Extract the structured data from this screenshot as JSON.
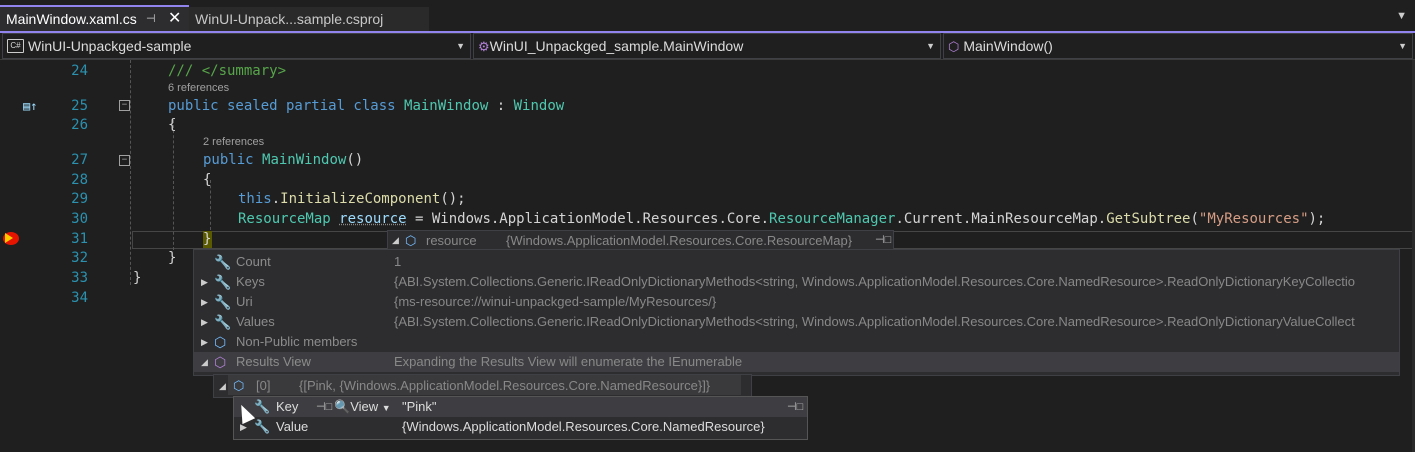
{
  "tabs": [
    {
      "label": "MainWindow.xaml.cs",
      "active": true
    },
    {
      "label": "WinUI-Unpack...sample.csproj",
      "active": false
    }
  ],
  "navbar": {
    "project": "WinUI-Unpackged-sample",
    "class_scope": "WinUI_Unpackged_sample.MainWindow",
    "member_scope": "MainWindow()"
  },
  "editor": {
    "line_numbers": [
      "24",
      "25",
      "26",
      "27",
      "28",
      "29",
      "30",
      "31",
      "32",
      "33",
      "34"
    ],
    "refs_class": "6 references",
    "refs_ctor": "2 references",
    "code": {
      "l24": "/// </summary>",
      "l25_kw": "public sealed partial class ",
      "l25_name": "MainWindow",
      "l25_colon": " : ",
      "l25_base": "Window",
      "l26": "{",
      "l27_kw": "public ",
      "l27_name": "MainWindow",
      "l27_parens": "()",
      "l28": "{",
      "l29_this": "this",
      "l29_dot": ".",
      "l29_call": "InitializeComponent",
      "l29_end": "();",
      "l30_type": "ResourceMap",
      "l30_var": "resource",
      "l30_eq": " = Windows.ApplicationModel.Resources.Core.",
      "l30_rm": "ResourceManager",
      "l30_mid": ".Current.MainResourceMap.",
      "l30_call": "GetSubtree",
      "l30_open": "(",
      "l30_str": "\"MyResources\"",
      "l30_close": ");",
      "l31": "}",
      "l32": "}",
      "l33": "}"
    }
  },
  "datatip": {
    "name": "resource",
    "value": "{Windows.ApplicationModel.Resources.Core.ResourceMap}",
    "rows": [
      {
        "name": "Count",
        "value": "1"
      },
      {
        "name": "Keys",
        "value": "{ABI.System.Collections.Generic.IReadOnlyDictionaryMethods<string, Windows.ApplicationModel.Resources.Core.NamedResource>.ReadOnlyDictionaryKeyCollectio"
      },
      {
        "name": "Uri",
        "value": "{ms-resource://winui-unpackged-sample/MyResources/}"
      },
      {
        "name": "Values",
        "value": "{ABI.System.Collections.Generic.IReadOnlyDictionaryMethods<string, Windows.ApplicationModel.Resources.Core.NamedResource>.ReadOnlyDictionaryValueCollect"
      },
      {
        "name": "Non-Public members",
        "value": ""
      },
      {
        "name": "Results View",
        "value": "Expanding the Results View will enumerate the IEnumerable"
      }
    ],
    "item0": {
      "name": "[0]",
      "value": "{[Pink, {Windows.ApplicationModel.Resources.Core.NamedResource}]}"
    },
    "item0_children": {
      "key_name": "Key",
      "view_label": "View",
      "key_value": "\"Pink\"",
      "value_name": "Value",
      "value_value": "{Windows.ApplicationModel.Resources.Core.NamedResource}"
    }
  },
  "colors": {
    "accent": "#9184ee",
    "background": "#1f1f1f",
    "keyword": "#569cd6",
    "type": "#4ec9b0",
    "string": "#d69d85",
    "breakpoint": "#e51400"
  }
}
